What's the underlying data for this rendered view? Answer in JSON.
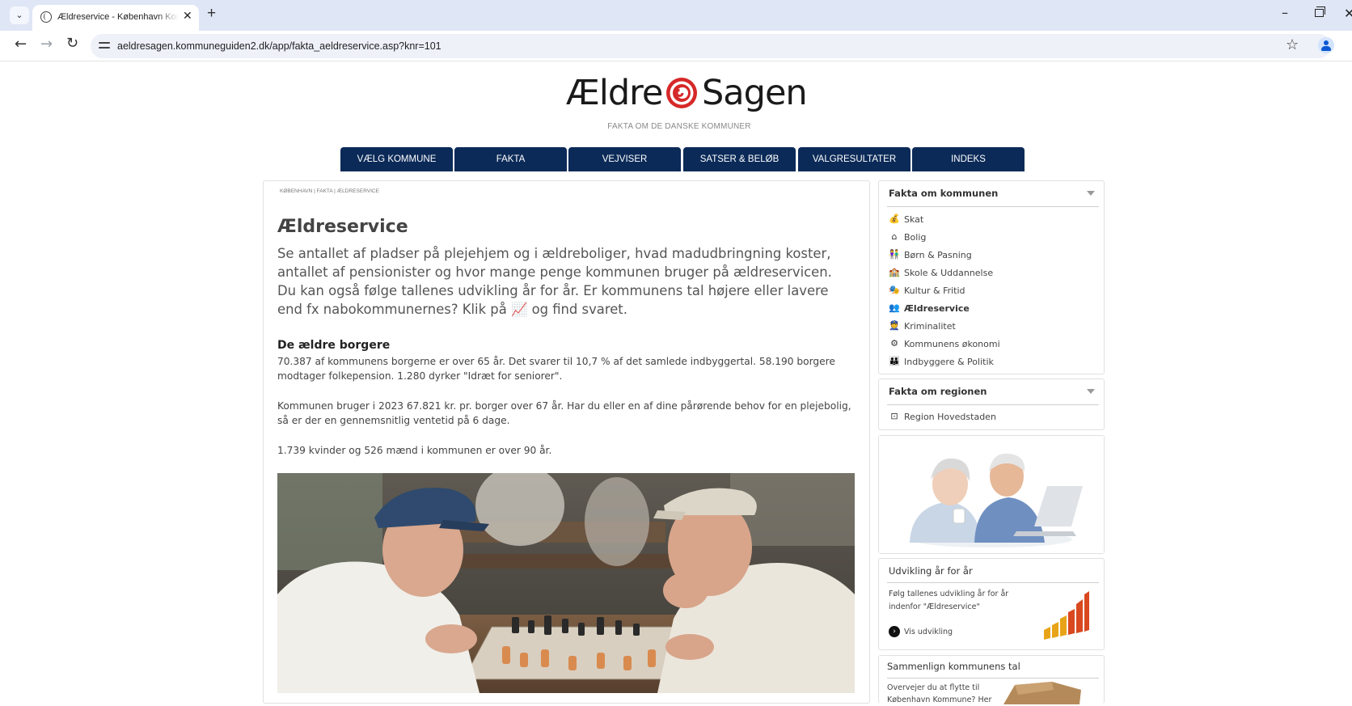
{
  "browser": {
    "tab_title": "Ældreservice - København Kommune",
    "tab_close": "✕",
    "new_tab": "+",
    "url": "aeldresagen.kommuneguiden2.dk/app/fakta_aeldreservice.asp?knr=101"
  },
  "header": {
    "logo_part1": "Ældre",
    "logo_part2": "Sagen",
    "tagline": "FAKTA OM DE DANSKE KOMMUNER"
  },
  "nav": {
    "items": [
      "VÆLG KOMMUNE",
      "FAKTA",
      "VEJVISER",
      "SATSER & BELØB",
      "VALGRESULTATER",
      "INDEKS"
    ]
  },
  "main": {
    "breadcrumb": "KØBENHAVN | FAKTA | ÆLDRESERVICE",
    "title": "Ældreservice",
    "intro": "Se antallet af pladser på plejehjem og i ældreboliger, hvad madudbringning koster, antallet af pensionister og hvor mange penge kommunen bruger på ældreservicen. Du kan også følge tallenes udvikling år for år. Er kommunens tal højere eller lavere end fx nabokommunernes? Klik på 📈 og find svaret.",
    "section_heading": "De ældre borgere",
    "paragraphs": [
      "70.387 af kommunens borgerne er over 65 år. Det svarer til 10,7 % af det samlede indbyggertal. 58.190 borgere modtager folkepension. 1.280 dyrker \"Idræt for seniorer\".",
      "Kommunen bruger i 2023 67.821 kr. pr. borger over 67 år. Har du eller en af dine pårørende behov for en plejebolig, så er der en gennemsnitlig ventetid på 6 dage.",
      "1.739 kvinder og 526 mænd i kommunen er over 90 år."
    ]
  },
  "sidebar": {
    "kommune_heading": "Fakta om kommunen",
    "kommune_items": [
      {
        "label": "Skat",
        "icon": "money-bag-icon"
      },
      {
        "label": "Bolig",
        "icon": "house-icon"
      },
      {
        "label": "Børn & Pasning",
        "icon": "children-icon"
      },
      {
        "label": "Skole & Uddannelse",
        "icon": "school-icon"
      },
      {
        "label": "Kultur & Fritid",
        "icon": "theater-masks-icon"
      },
      {
        "label": "Ældreservice",
        "icon": "elderly-icon",
        "active": true
      },
      {
        "label": "Kriminalitet",
        "icon": "police-icon"
      },
      {
        "label": "Kommunens økonomi",
        "icon": "coins-icon"
      },
      {
        "label": "Indbyggere & Politik",
        "icon": "people-icon"
      }
    ],
    "region_heading": "Fakta om regionen",
    "region_item": "Region Hovedstaden",
    "udvikling_heading": "Udvikling år for år",
    "udvikling_text_1": "Følg tallenes udvikling år for år",
    "udvikling_text_2": "indenfor \"Ældreservice\"",
    "udvikling_link": "Vis udvikling",
    "sammenlign_heading": "Sammenlign kommunens tal",
    "sammenlign_text_1": "Overvejer du at flytte til",
    "sammenlign_text_2": "København Kommune? Her"
  },
  "colors": {
    "nav_bg": "#0b2a58",
    "logo_red": "#d62828",
    "text_dark": "#333333"
  }
}
